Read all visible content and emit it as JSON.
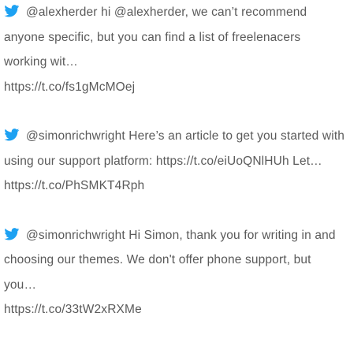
{
  "tweets": [
    {
      "icon": "twitter-bird-icon",
      "text": "@alexherder hi @alexherder, we can’t recommend anyone specific, but you can find a list of freelenacers working wit…",
      "link": "https://t.co/fs1gMcMOej"
    },
    {
      "icon": "twitter-bird-icon",
      "text": "@simonrichwright Here’s an article to get you started with using our support platform: https://t.co/eiUoQNlHUh Let…",
      "link": "https://t.co/PhSMKT4Rph"
    },
    {
      "icon": "twitter-bird-icon",
      "text": "@simonrichwright Hi Simon, thank you for writing in and choosing our themes. We don't offer phone support, but you…",
      "link": "https://t.co/33tW2xRXMe"
    }
  ],
  "colors": {
    "icon": "#1da1f2",
    "text": "#5a5a5a"
  }
}
